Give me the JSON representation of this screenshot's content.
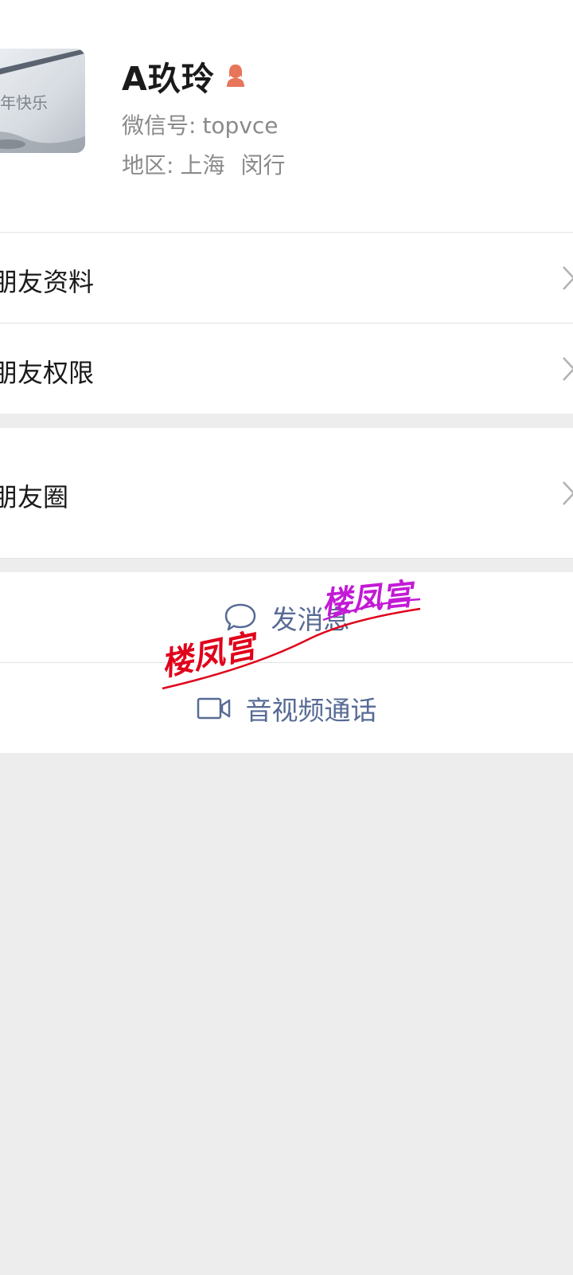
{
  "profile": {
    "name": "A玖玲",
    "wechat_label": "微信号:",
    "wechat_id": "topvce",
    "region_label": "地区:",
    "region_city": "上海",
    "region_district": "闵行",
    "avatar_text": "新年快乐",
    "gender_icon": "female-icon",
    "gender_color": "#e8745a"
  },
  "menu": {
    "friend_info": "朋友资料",
    "friend_permissions": "朋友权限",
    "moments": "朋友圈"
  },
  "actions": {
    "send_message": "发消息",
    "av_call": "音视频通话",
    "link_color": "#576b95"
  },
  "watermark": {
    "text_red": "楼凤宫",
    "text_purple": "楼凤宫"
  }
}
